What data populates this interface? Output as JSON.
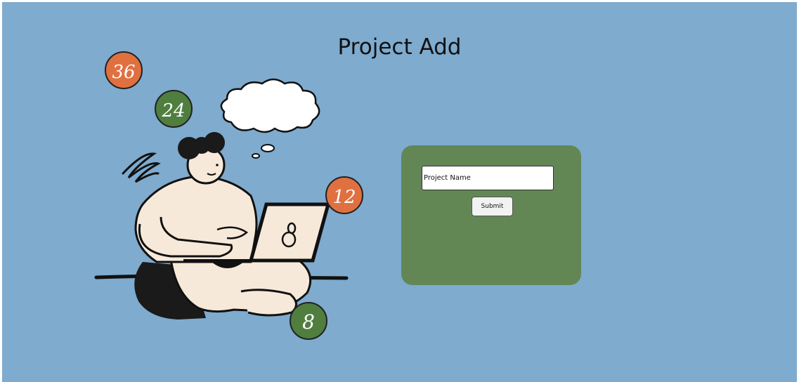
{
  "header": {
    "title": "Project Add"
  },
  "illustration": {
    "badges": [
      {
        "number": "36",
        "color": "#e0703f"
      },
      {
        "number": "24",
        "color": "#4f7e3f"
      },
      {
        "number": "12",
        "color": "#e0703f"
      },
      {
        "number": "8",
        "color": "#4f7e3f"
      }
    ]
  },
  "form": {
    "project_name_placeholder": "Project Name",
    "project_name_value": "",
    "submit_label": "Submit"
  },
  "colors": {
    "background": "#7eabce",
    "card": "#628754",
    "badge_orange": "#e0703f",
    "badge_green": "#4f7e3f"
  }
}
